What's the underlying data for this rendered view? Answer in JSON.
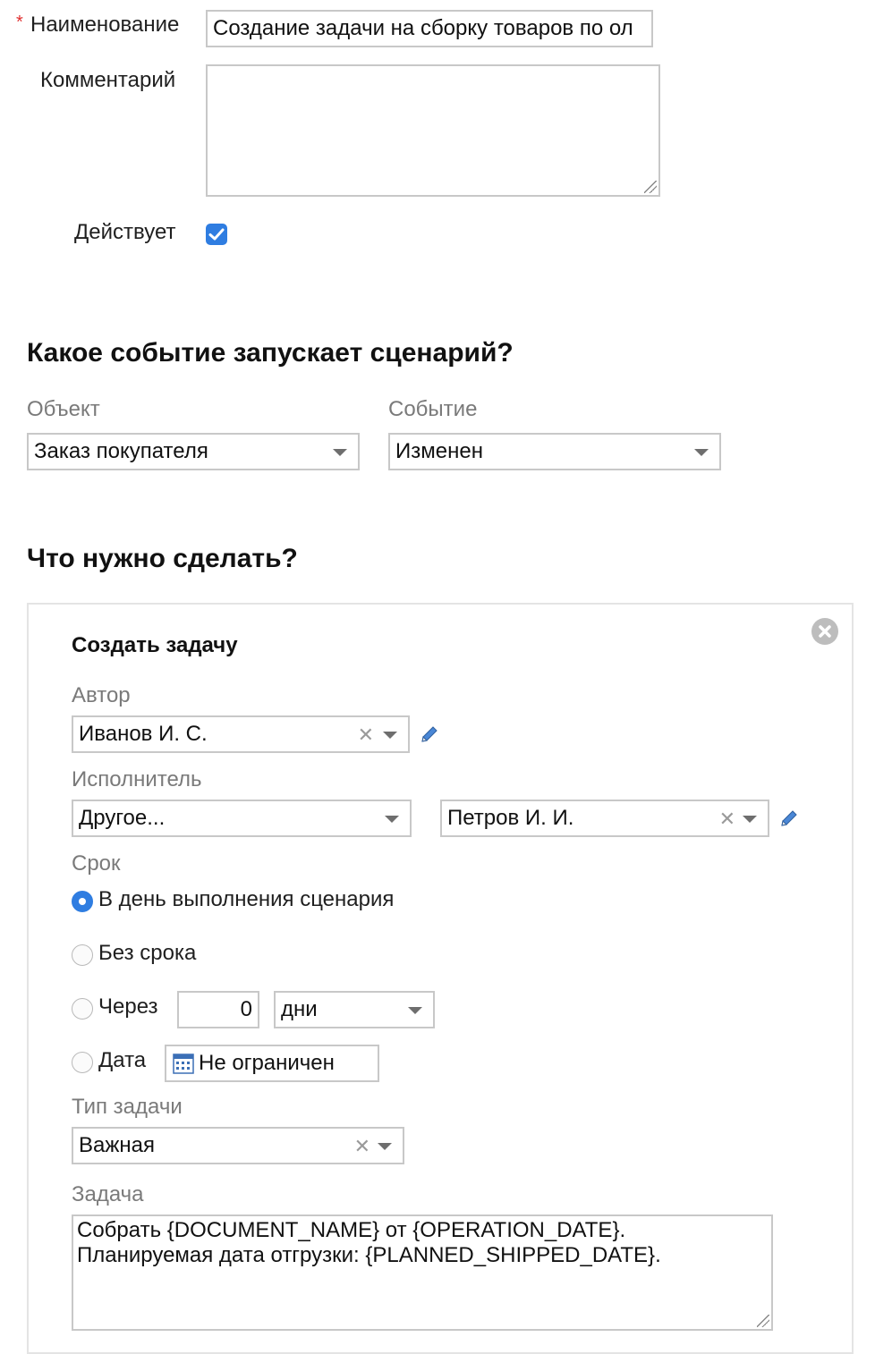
{
  "form": {
    "name_label": "Наименование",
    "name_required_mark": "*",
    "name_value": "Создание задачи на сборку товаров по ол",
    "comment_label": "Комментарий",
    "comment_value": "",
    "active_label": "Действует",
    "active_checked": true
  },
  "trigger": {
    "heading": "Какое событие запускает сценарий?",
    "object_label": "Объект",
    "object_value": "Заказ покупателя",
    "event_label": "Событие",
    "event_value": "Изменен"
  },
  "action": {
    "heading": "Что нужно сделать?",
    "card_title": "Создать задачу",
    "author_label": "Автор",
    "author_value": "Иванов И. С.",
    "assignee_label": "Исполнитель",
    "assignee_type_value": "Другое...",
    "assignee_value": "Петров И. И.",
    "deadline_label": "Срок",
    "deadline_options": {
      "on_day": "В день выполнения сценария",
      "none": "Без срока",
      "after": "Через",
      "date": "Дата"
    },
    "deadline_selected": "on_day",
    "after_value": "0",
    "after_unit": "дни",
    "date_value": "Не ограничен",
    "task_type_label": "Тип задачи",
    "task_type_value": "Важная",
    "task_label": "Задача",
    "task_value": "Собрать {DOCUMENT_NAME} от {OPERATION_DATE}. Планируемая дата отгрузки: {PLANNED_SHIPPED_DATE}."
  },
  "colors": {
    "accent": "#2f7de1",
    "required": "#e03030",
    "border": "#c8c8c8"
  }
}
